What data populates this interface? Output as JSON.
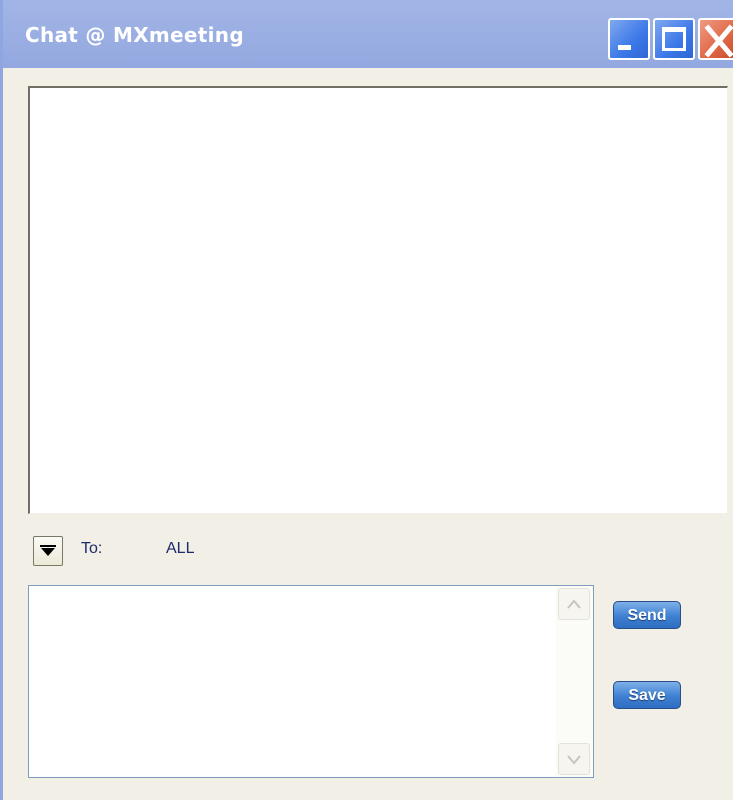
{
  "window": {
    "title": "Chat @ MXmeeting"
  },
  "recipient": {
    "label": "To:",
    "value": "ALL"
  },
  "message": {
    "value": ""
  },
  "actions": {
    "send_label": "Send",
    "save_label": "Save"
  },
  "icons": {
    "minimize": "minimize-icon",
    "maximize": "maximize-icon",
    "close": "close-icon",
    "dropdown": "triangle-down-icon",
    "scroll_up": "chevron-up-icon",
    "scroll_down": "chevron-down-icon"
  },
  "colors": {
    "titlebar": "#9cb0e4",
    "window_bg": "#f1efe6",
    "label_text": "#1d2a6b",
    "button": "#3f80d2"
  }
}
